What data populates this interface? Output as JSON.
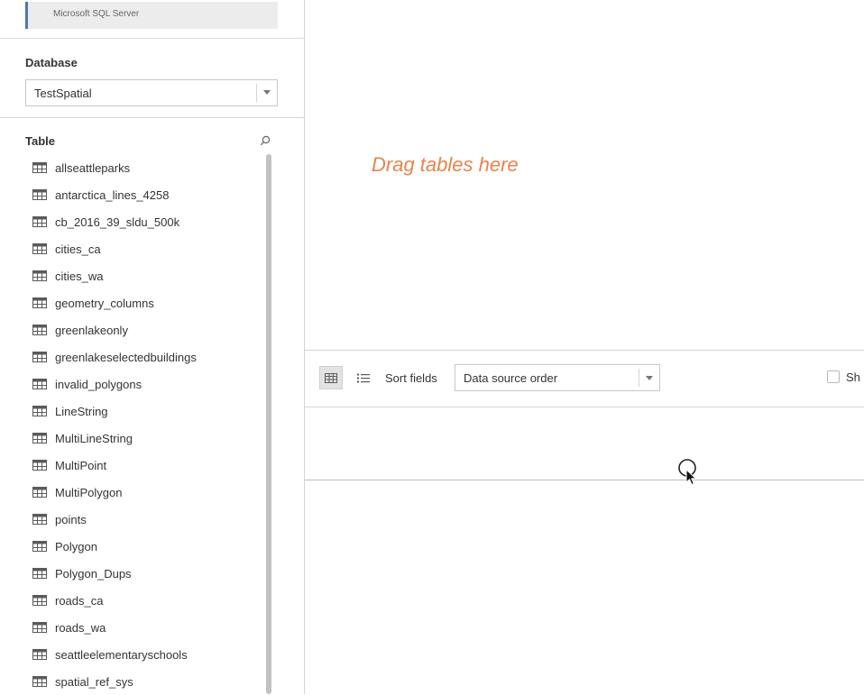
{
  "connection": {
    "label": "Microsoft SQL Server"
  },
  "database": {
    "heading": "Database",
    "selected": "TestSpatial"
  },
  "tables": {
    "heading": "Table",
    "items": [
      "allseattleparks",
      "antarctica_lines_4258",
      "cb_2016_39_sldu_500k",
      "cities_ca",
      "cities_wa",
      "geometry_columns",
      "greenlakeonly",
      "greenlakeselectedbuildings",
      "invalid_polygons",
      "LineString",
      "MultiLineString",
      "MultiPoint",
      "MultiPolygon",
      "points",
      "Polygon",
      "Polygon_Dups",
      "roads_ca",
      "roads_wa",
      "seattleelementaryschools",
      "spatial_ref_sys"
    ]
  },
  "canvas": {
    "hint": "Drag tables here"
  },
  "toolbar": {
    "sort_label": "Sort fields",
    "sort_value": "Data source order",
    "show_label": "Sh"
  },
  "colors": {
    "hint": "#e8834e",
    "accent": "#4e79a7",
    "icon": "#5a5a5a"
  },
  "icons": {
    "table_item": "table-grid-icon",
    "search": "search-icon",
    "grid_view": "grid-view-icon",
    "list_view": "list-view-icon",
    "dropdown": "chevron-down-icon",
    "cursor": "mouse-pointer-icon"
  }
}
